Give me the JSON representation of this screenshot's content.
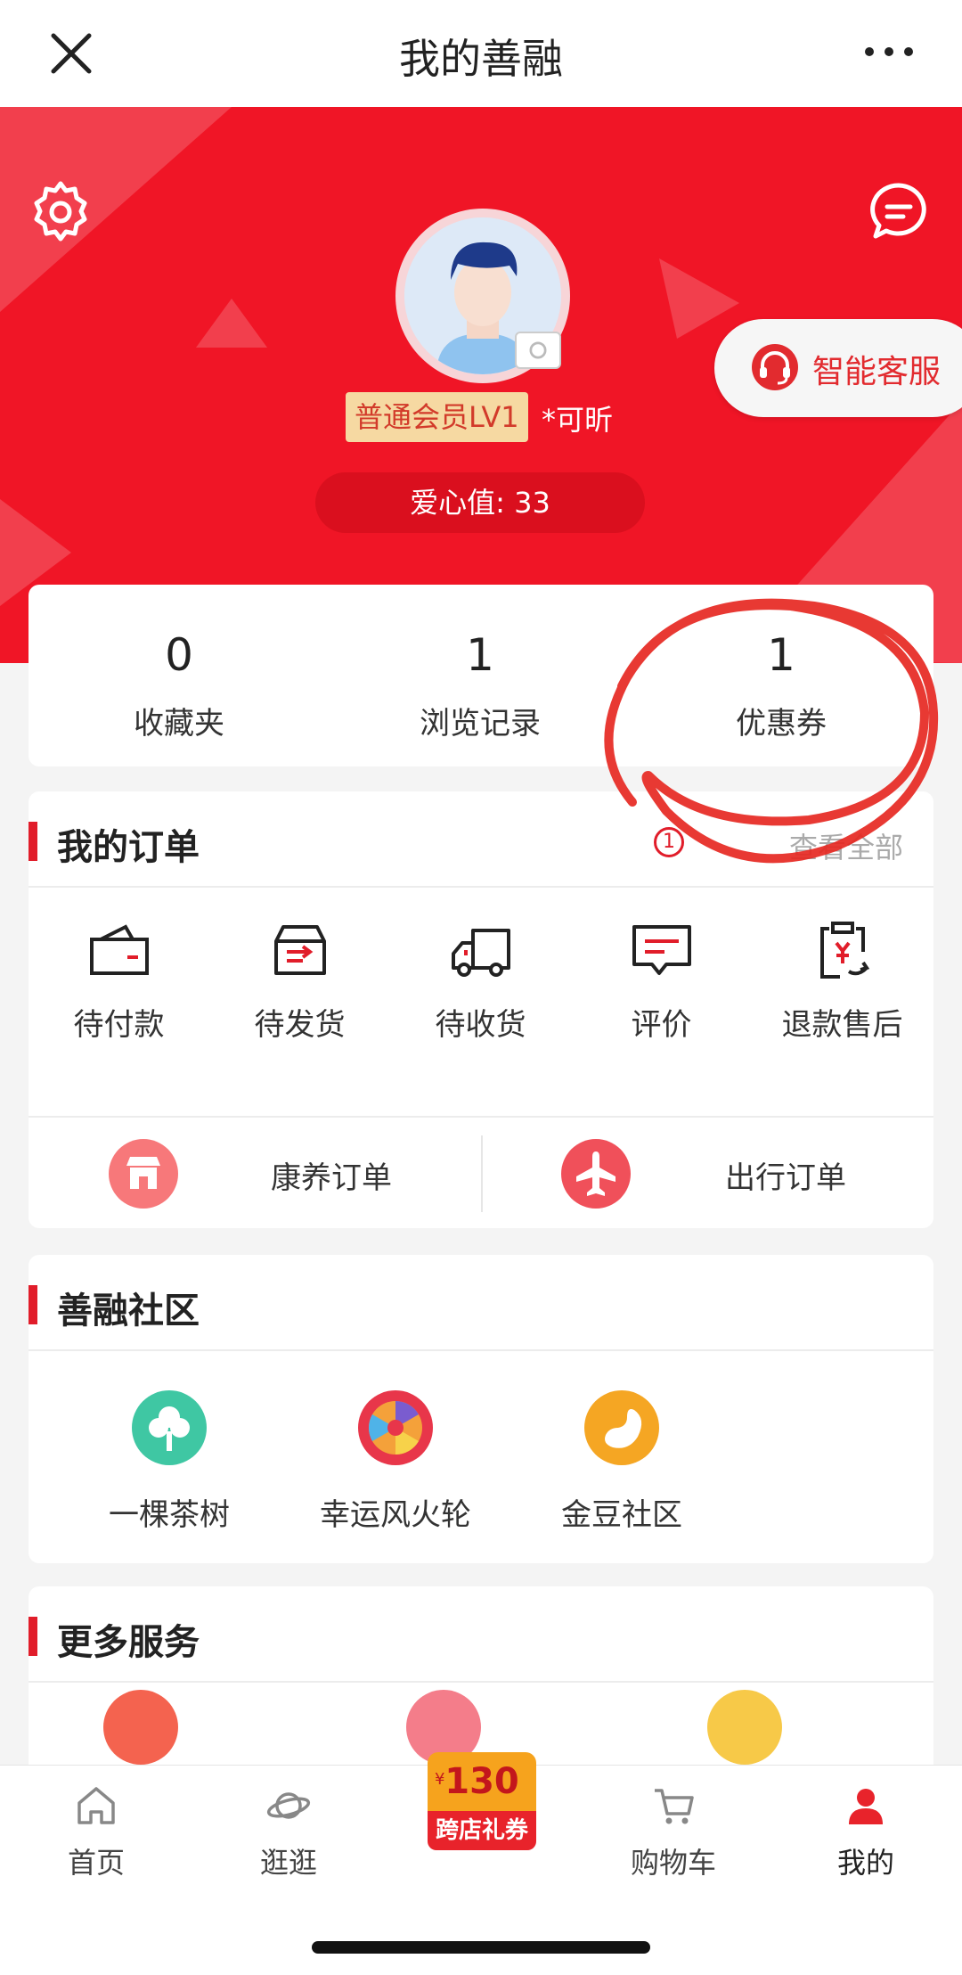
{
  "nav": {
    "title": "我的善融",
    "close_icon": "close-icon",
    "more_icon": "more-icon"
  },
  "header": {
    "level": "普通会员LV1",
    "nickname": "*可昕",
    "love_value": "爱心值: 33",
    "service_label": "智能客服",
    "bg_color": "#f01526"
  },
  "stats": [
    {
      "num": "0",
      "label": "收藏夹"
    },
    {
      "num": "1",
      "label": "浏览记录"
    },
    {
      "num": "1",
      "label": "优惠券"
    }
  ],
  "orders": {
    "title": "我的订单",
    "view_all": "查看全部",
    "items": [
      {
        "label": "待付款",
        "icon": "wallet-icon"
      },
      {
        "label": "待发货",
        "icon": "box-icon"
      },
      {
        "label": "待收货",
        "icon": "truck-icon"
      },
      {
        "label": "评价",
        "icon": "comment-icon",
        "badge": "1"
      },
      {
        "label": "退款售后",
        "icon": "refund-icon"
      }
    ],
    "sub": [
      {
        "label": "康养订单",
        "icon": "shop-icon"
      },
      {
        "label": "出行订单",
        "icon": "plane-icon"
      }
    ]
  },
  "community": {
    "title": "善融社区",
    "items": [
      {
        "label": "一棵茶树",
        "icon": "tree-icon"
      },
      {
        "label": "幸运风火轮",
        "icon": "wheel-icon"
      },
      {
        "label": "金豆社区",
        "icon": "bean-icon"
      }
    ]
  },
  "more": {
    "title": "更多服务"
  },
  "tabbar": {
    "items": [
      {
        "label": "首页",
        "icon": "home-icon"
      },
      {
        "label": "逛逛",
        "icon": "planet-icon"
      },
      {
        "label": "购物车",
        "icon": "cart-icon"
      },
      {
        "label": "我的",
        "icon": "user-icon"
      }
    ],
    "promo_amount": "130",
    "promo_yen": "¥",
    "promo_label": "跨店礼券"
  },
  "accent_color": "#e11d2a"
}
